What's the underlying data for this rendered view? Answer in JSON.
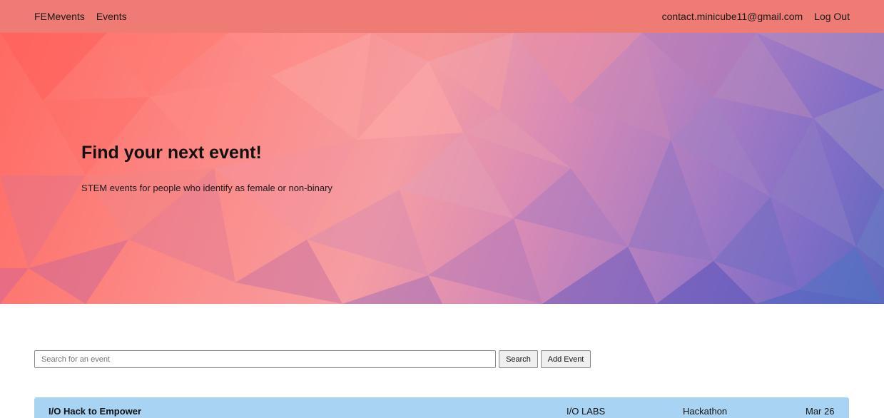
{
  "navbar": {
    "brand": "FEMevents",
    "events_link": "Events",
    "user_email": "contact.minicube11@gmail.com",
    "logout": "Log Out"
  },
  "hero": {
    "title": "Find your next event!",
    "subtitle": "STEM events for people who identify as female or non-binary"
  },
  "search": {
    "placeholder": "Search for an event",
    "search_button": "Search",
    "add_button": "Add Event"
  },
  "events": [
    {
      "title": "I/O Hack to Empower",
      "organizer": "I/O LABS",
      "type": "Hackathon",
      "date": "Mar 26"
    }
  ],
  "colors": {
    "navbar": "#ef7c74",
    "event_row": "#a9d3f2"
  }
}
